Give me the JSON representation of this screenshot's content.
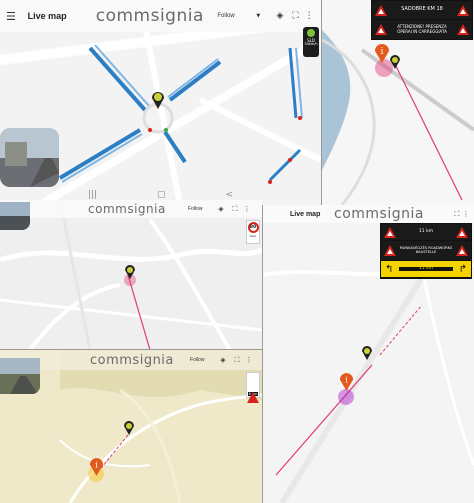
{
  "app": {
    "title": "Live map",
    "logo_main": "commsignia",
    "logo_highlight": "o",
    "follow_label": "Follow",
    "menu_icon": "hamburger-icon",
    "layers_icon": "layers-icon",
    "fullscreen_icon": "fullscreen-icon",
    "more_icon": "more-vert-icon"
  },
  "panel_a": {
    "speed_status": "SLD",
    "speed_value": "34km/h"
  },
  "panel_b": {
    "sign_rows": [
      "SADOBRE  KM 18",
      "ATTENZIONE! PRESENZA OPERAI IN CARREGGIATA"
    ]
  },
  "panel_c": {
    "speed_limit": "80",
    "speed_unit": "SGLI"
  },
  "panel_d": {
    "limit_dist": "8 km"
  },
  "panel_e": {
    "sign_rows": [
      "11 km",
      "MUNKAVÉGZÉS ROADWORKS BAUSTELLE",
      "11 km"
    ]
  },
  "colors": {
    "road_blue": "#2c7fc4",
    "trajectory": "#e0397a",
    "warning_red": "#d4241b",
    "brand_green": "#6aa42e",
    "satellite_bg": "#efe9c9"
  }
}
